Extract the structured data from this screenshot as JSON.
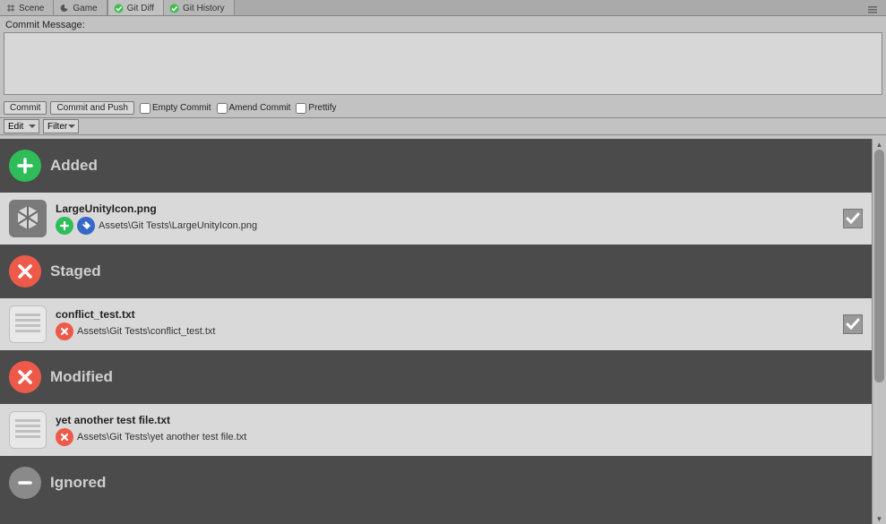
{
  "tabs": [
    {
      "label": "Scene",
      "icon": "grid"
    },
    {
      "label": "Game",
      "icon": "pac"
    },
    {
      "label": "Git Diff",
      "icon": "check-green"
    },
    {
      "label": "Git History",
      "icon": "check-green"
    }
  ],
  "active_tab_index": 2,
  "commit": {
    "message_label": "Commit Message:",
    "message_value": "",
    "commit_btn": "Commit",
    "commit_push_btn": "Commit and Push",
    "checkboxes": {
      "empty": "Empty Commit",
      "amend": "Amend Commit",
      "prettify": "Prettify"
    }
  },
  "dropdowns": {
    "edit": "Edit",
    "filter": "Filter"
  },
  "sections": [
    {
      "title": "Added",
      "icon_type": "plus-green",
      "files": [
        {
          "name": "LargeUnityIcon.png",
          "path": "Assets\\Git Tests\\LargeUnityIcon.png",
          "thumb_type": "unity",
          "status_icons": [
            "plus-green-mini",
            "tag-blue-mini"
          ],
          "checked": true
        }
      ]
    },
    {
      "title": "Staged",
      "icon_type": "x-red",
      "files": [
        {
          "name": "conflict_test.txt",
          "path": "Assets\\Git Tests\\conflict_test.txt",
          "thumb_type": "doc",
          "status_icons": [
            "x-red-mini"
          ],
          "checked": true
        }
      ]
    },
    {
      "title": "Modified",
      "icon_type": "x-red",
      "files": [
        {
          "name": "yet another test file.txt",
          "path": "Assets\\Git Tests\\yet another test file.txt",
          "thumb_type": "doc",
          "status_icons": [
            "x-red-mini"
          ],
          "checked": false
        }
      ]
    },
    {
      "title": "Ignored",
      "icon_type": "minus-grey",
      "files": []
    }
  ]
}
